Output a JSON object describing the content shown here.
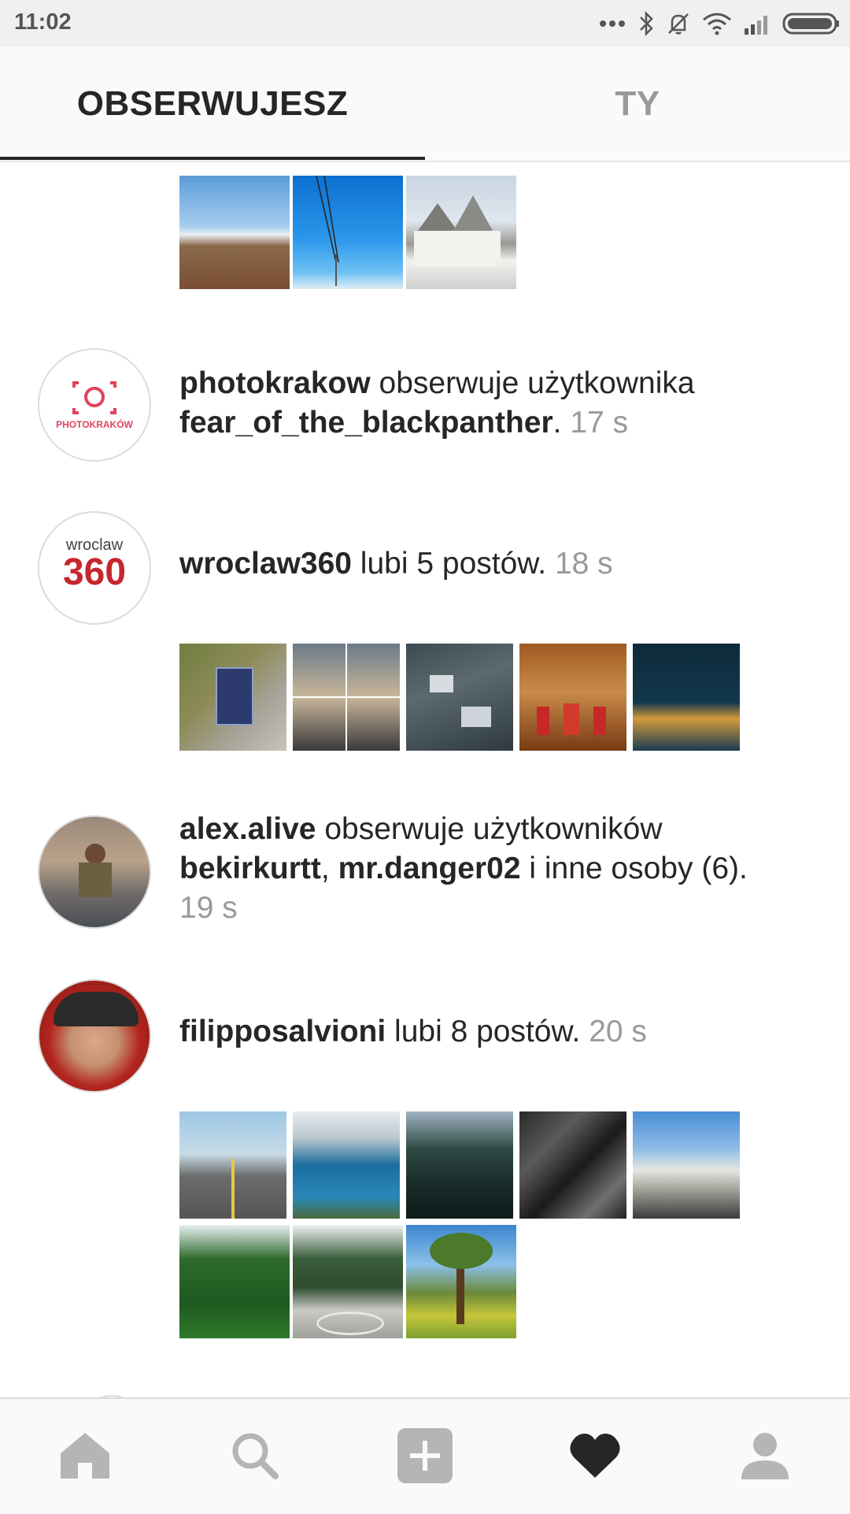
{
  "status": {
    "time": "11:02"
  },
  "tabs": {
    "following": "OBSERWUJESZ",
    "you": "TY"
  },
  "entries": [
    {
      "user": "photokrakow",
      "action": " obserwuje użytkownika ",
      "target": "fear_of_the_blackpanther",
      "end": ".",
      "time": "17 s",
      "avatar_text": "PHOTOKRAKÓW"
    },
    {
      "user": "wroclaw360",
      "action": " lubi 5 postów. ",
      "time": "18 s",
      "avatar_text": "wroclaw",
      "avatar_num": "360"
    },
    {
      "user": "alex.alive",
      "action": " obserwuje użytkowników ",
      "target1": "bekirkurtt",
      "sep": ", ",
      "target2": "mr.danger02",
      "end": " i inne osoby (6).",
      "time": "19 s"
    },
    {
      "user": "filipposalvioni",
      "action": " lubi 8 postów. ",
      "time": "20 s"
    }
  ],
  "nav": [
    "home-icon",
    "search-icon",
    "add-icon",
    "heart-icon",
    "profile-icon"
  ],
  "colors": {
    "accent": "#262626",
    "muted": "#999999",
    "divider": "#dbdbdb"
  }
}
